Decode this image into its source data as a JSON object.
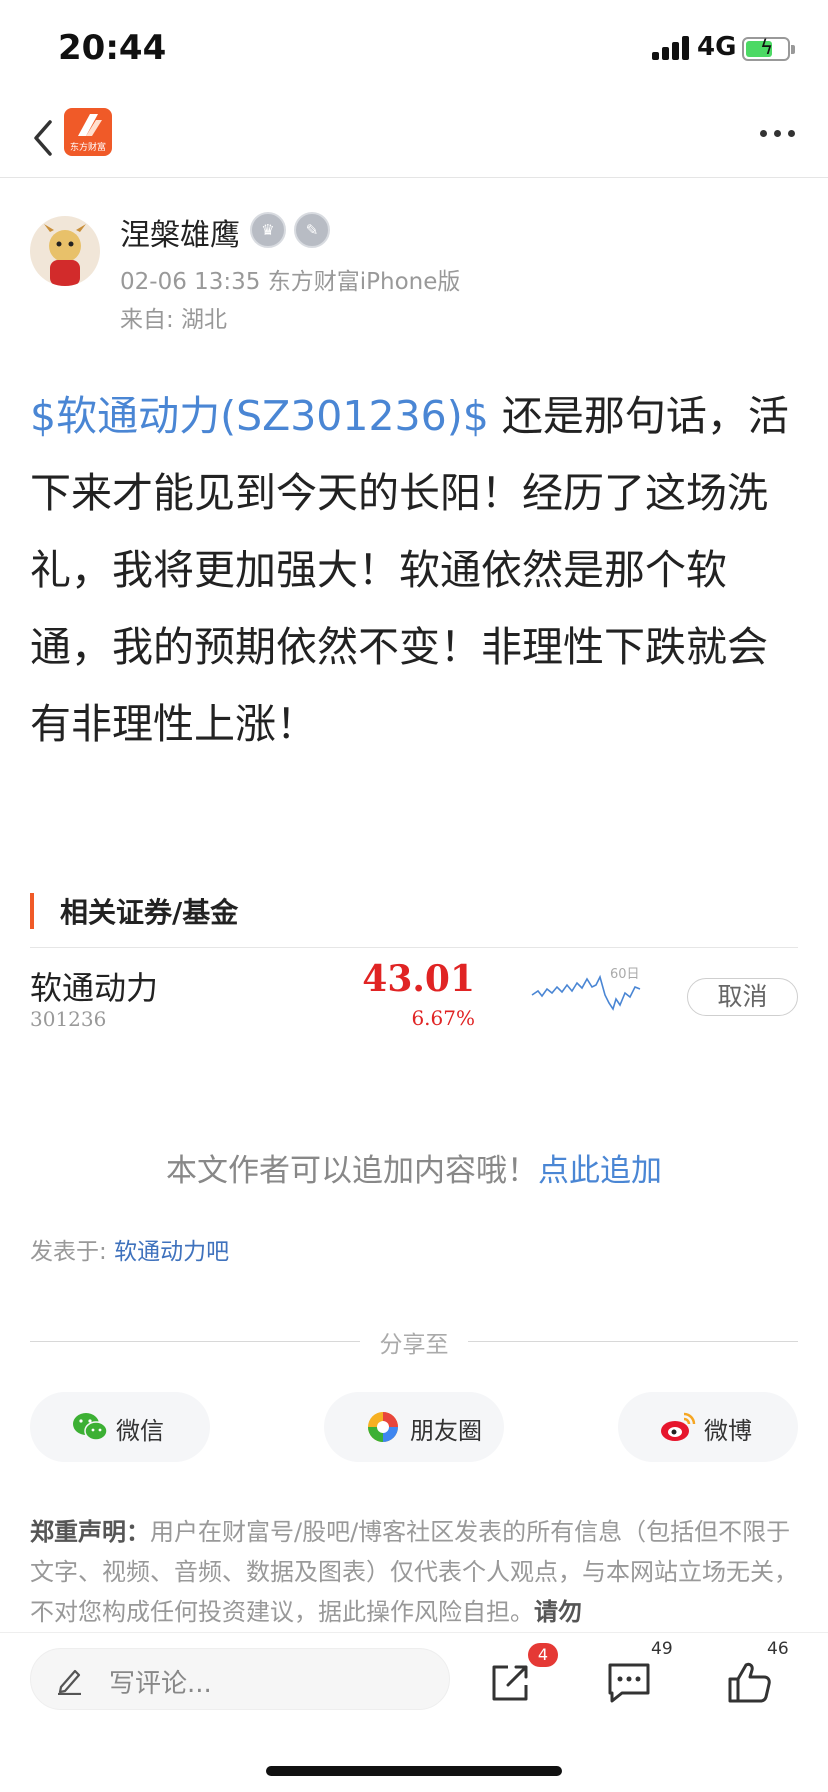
{
  "status_bar": {
    "time": "20:44",
    "network": "4G",
    "battery_level": 0.65
  },
  "nav": {
    "logo_text": "东方财富"
  },
  "author": {
    "name": "涅槃雄鹰",
    "meta": "02-06 13:35  东方财富iPhone版",
    "location": "来自: 湖北"
  },
  "post": {
    "stock_tag": "$软通动力(SZ301236)$",
    "text": " 还是那句话，活下来才能见到今天的长阳！经历了这场洗礼，我将更加强大！软通依然是那个软通，我的预期依然不变！非理性下跌就会有非理性上涨！"
  },
  "related": {
    "title": "相关证券/基金",
    "stock": {
      "name": "软通动力",
      "code": "301236",
      "price": "43.01",
      "change": "6.67%",
      "chart_label": "60日",
      "cancel_label": "取消"
    }
  },
  "append": {
    "text": "本文作者可以追加内容哦！",
    "link": "点此追加"
  },
  "posted_in": {
    "label": "发表于: ",
    "bar": "软通动力吧"
  },
  "share": {
    "label": "分享至",
    "buttons": [
      {
        "label": "微信",
        "icon": "wechat-icon"
      },
      {
        "label": "朋友圈",
        "icon": "moments-icon"
      },
      {
        "label": "微博",
        "icon": "weibo-icon"
      }
    ]
  },
  "disclaimer": {
    "title": "郑重声明：",
    "text": "用户在财富号/股吧/博客社区发表的所有信息（包括但不限于文字、视频、音频、数据及图表）仅代表个人观点，与本网站立场无关，不对您构成任何投资建议，据此操作风险自担。",
    "tail": "请勿"
  },
  "bottom_bar": {
    "comment_placeholder": "写评论...",
    "share_count": "4",
    "comment_count": "49",
    "like_count": "46"
  },
  "colors": {
    "accent": "#f05a28",
    "link": "#4a86d4",
    "up": "#e02424"
  }
}
